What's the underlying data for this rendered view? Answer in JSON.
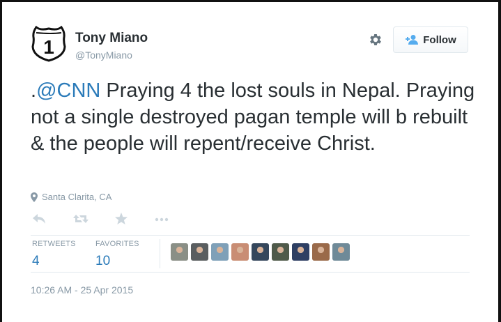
{
  "user": {
    "name": "Tony Miano",
    "handle": "@TonyMiano",
    "avatar_icon": "route-1-shield-icon",
    "avatar_text": "1"
  },
  "header": {
    "settings_icon": "gear-icon",
    "follow_label": "Follow",
    "follow_icon": "add-person-icon"
  },
  "tweet": {
    "prefix": ".",
    "mention": "@CNN",
    "text": " Praying 4 the lost souls in Nepal. Praying not a single destroyed pagan temple will b rebuilt & the people will repent/receive Christ."
  },
  "location": {
    "icon": "map-pin-icon",
    "text": "Santa Clarita, CA"
  },
  "actions": [
    {
      "name": "reply",
      "icon": "reply-icon"
    },
    {
      "name": "retweet",
      "icon": "retweet-icon"
    },
    {
      "name": "favorite",
      "icon": "star-icon"
    },
    {
      "name": "more",
      "icon": "more-icon"
    }
  ],
  "stats": {
    "retweets_label": "RETWEETS",
    "retweets_count": "4",
    "favorites_label": "FAVORITES",
    "favorites_count": "10"
  },
  "favoriters": [
    {
      "color": "#8a8f86"
    },
    {
      "color": "#5a5e60"
    },
    {
      "color": "#7fa0b8"
    },
    {
      "color": "#c98d74"
    },
    {
      "color": "#35475c"
    },
    {
      "color": "#4f5a4a"
    },
    {
      "color": "#2e3f63"
    },
    {
      "color": "#9a6a4a"
    },
    {
      "color": "#6f8a98"
    }
  ],
  "timestamp": "10:26 AM - 25 Apr 2015",
  "colors": {
    "link": "#2b7bb9",
    "muted": "#8899a6",
    "text": "#292f33",
    "border": "#e1e8ed"
  }
}
